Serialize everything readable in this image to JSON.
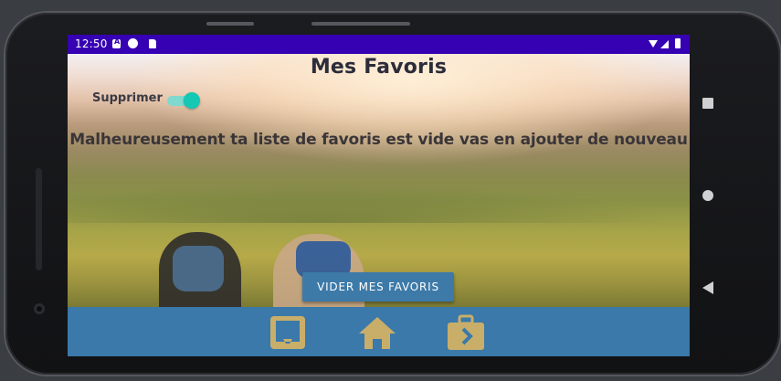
{
  "status_bar": {
    "time": "12:50",
    "icons": [
      "a-icon",
      "p-icon",
      "sd-card-icon",
      "wifi-icon",
      "signal-icon",
      "battery-icon"
    ]
  },
  "page": {
    "title": "Mes Favoris",
    "delete_label": "Supprimer",
    "delete_toggle_on": true,
    "empty_message": "Malheureusement ta liste de favoris est vide vas en ajouter de nouveau",
    "clear_button_label": "VIDER MES FAVORIS"
  },
  "bottom_nav": {
    "items": [
      "inbox-icon",
      "home-icon",
      "briefcase-icon"
    ]
  },
  "colors": {
    "status_bar": "#3600b3",
    "bottom_nav": "#3a79a9",
    "nav_icon": "#c9ae6a",
    "button": "#3d7aa8",
    "toggle": "#14c8b4"
  }
}
